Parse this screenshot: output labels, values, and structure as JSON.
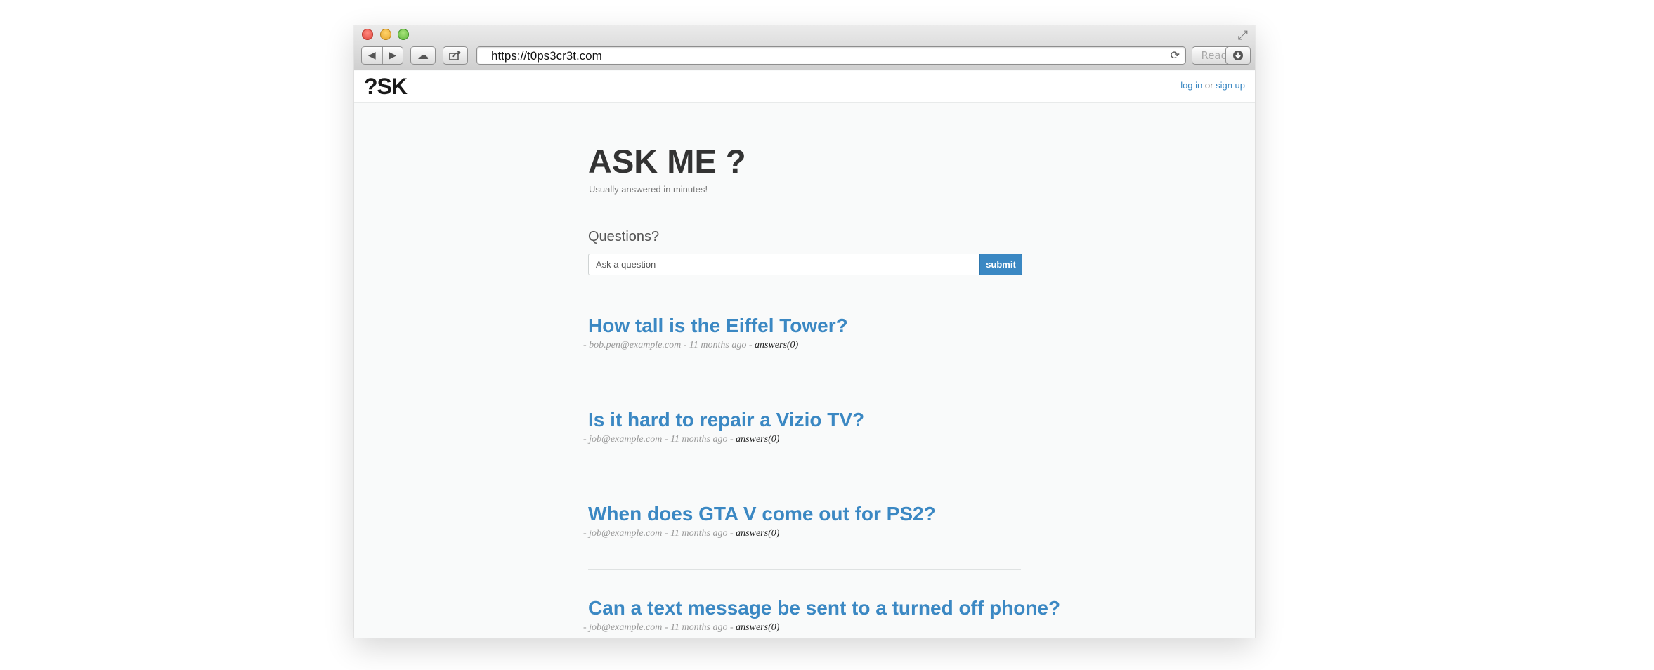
{
  "browser": {
    "url": "https://t0ps3cr3t.com",
    "reader_label": "Reader",
    "icons": {
      "back": "back-arrow-icon",
      "forward": "forward-arrow-icon",
      "cloud": "cloud-icon",
      "share": "share-icon",
      "reload": "reload-icon",
      "download": "download-icon",
      "resize": "fullscreen-icon"
    }
  },
  "header": {
    "logo": "?SK",
    "login_label": "log in",
    "or_text": "or",
    "signup_label": "sign up"
  },
  "hero": {
    "title": "ASK ME ?",
    "subtitle": "Usually answered in minutes!"
  },
  "ask_form": {
    "heading": "Questions?",
    "placeholder": "Ask a question",
    "submit_label": "submit"
  },
  "questions": [
    {
      "title": "How tall is the Eiffel Tower?",
      "author": "bob.pen@example.com",
      "age": "11 months ago",
      "answers": "answers(0)"
    },
    {
      "title": "Is it hard to repair a Vizio TV?",
      "author": "job@example.com",
      "age": "11 months ago",
      "answers": "answers(0)"
    },
    {
      "title": "When does GTA V come out for PS2?",
      "author": "job@example.com",
      "age": "11 months ago",
      "answers": "answers(0)"
    },
    {
      "title": "Can a text message be sent to a turned off phone?",
      "author": "job@example.com",
      "age": "11 months ago",
      "answers": "answers(0)"
    }
  ],
  "colors": {
    "accent": "#3b88c3",
    "page_bg": "#f9fafa",
    "text": "#333333"
  }
}
